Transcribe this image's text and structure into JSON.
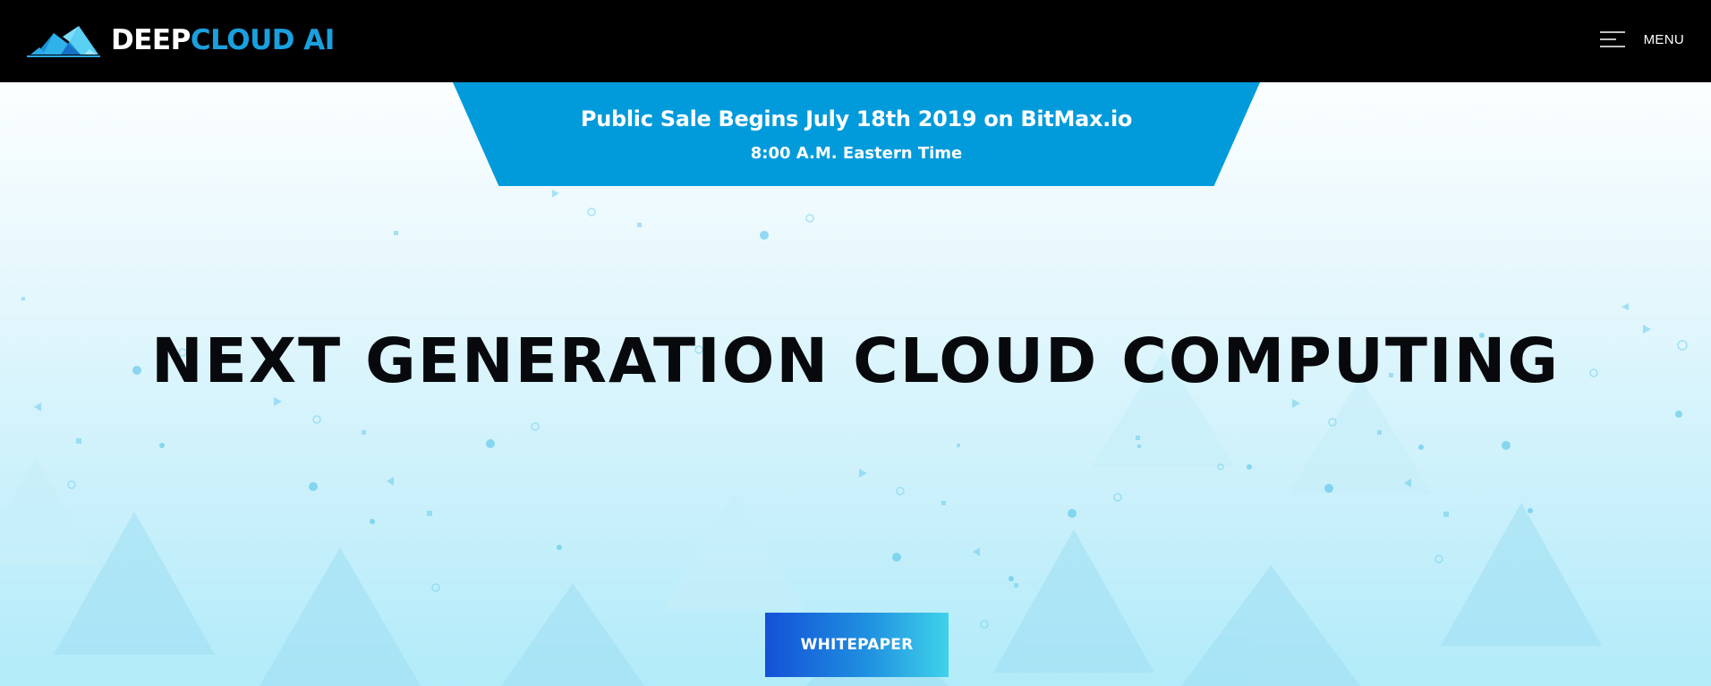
{
  "header": {
    "logo": {
      "part_white": "DEEP",
      "part_blue": "CLOUD",
      "part_white_2": " AI",
      "icon": "cloud-pyramid-icon"
    },
    "menu": {
      "icon": "hamburger-icon",
      "label": "MENU"
    }
  },
  "banner": {
    "line1": "Public Sale Begins July 18th 2019 on BitMax.io",
    "line2": "8:00 A.M. Eastern Time"
  },
  "hero": {
    "headline": "NEXT GENERATION CLOUD COMPUTING",
    "button_label": "WHITEPAPER"
  },
  "colors": {
    "header_bg": "#000000",
    "brand_blue": "#1aa0de",
    "banner_bg": "#019bdb",
    "headline": "#07090c",
    "button_start": "#1451d6",
    "button_end": "#3fd2ea"
  }
}
